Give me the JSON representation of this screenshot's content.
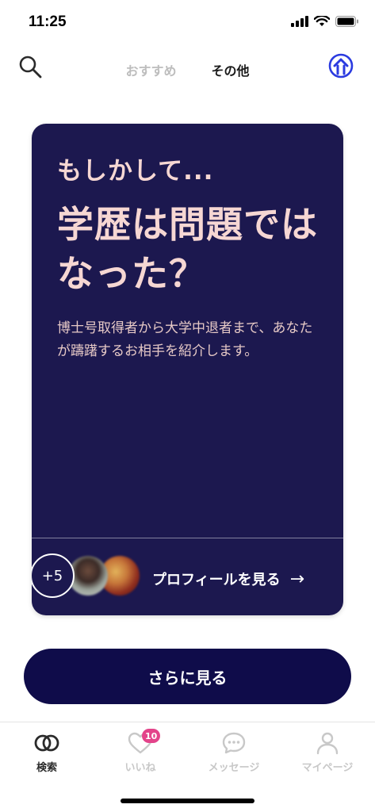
{
  "status_bar": {
    "time": "11:25"
  },
  "top_nav": {
    "tabs": [
      {
        "label": "おすすめ",
        "active": false
      },
      {
        "label": "その他",
        "active": true
      }
    ]
  },
  "card": {
    "eyebrow": "もしかして...",
    "title": "学歴は問題ではなった？",
    "body": "博士号取得者から大学中退者まで、あなたが躊躇するお相手を紹介します。",
    "more_count": "+5",
    "view_profiles_label": "プロフィールを見る",
    "arrow": "→"
  },
  "more_button": {
    "label": "さらに見る"
  },
  "tab_bar": {
    "items": [
      {
        "label": "検索",
        "icon": "search-rings-icon",
        "active": true
      },
      {
        "label": "いいね",
        "icon": "heart-icon",
        "active": false,
        "badge": "10"
      },
      {
        "label": "メッセージ",
        "icon": "chat-bubble-icon",
        "active": false
      },
      {
        "label": "マイページ",
        "icon": "person-icon",
        "active": false
      }
    ]
  },
  "colors": {
    "card_bg": "#1c184f",
    "card_text": "#f6d7d3",
    "button_bg": "#0f0c4a",
    "accent_blue": "#2b3be0",
    "badge_pink": "#e3438a"
  }
}
